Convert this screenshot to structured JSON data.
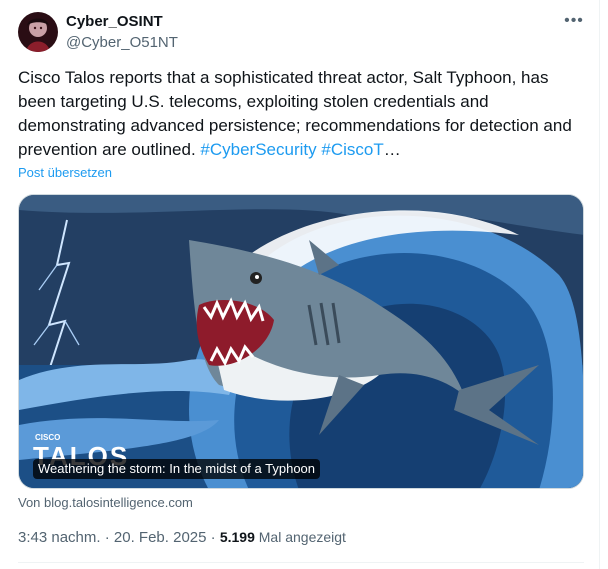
{
  "author": {
    "display_name": "Cyber_OSINT",
    "handle": "@Cyber_O51NT"
  },
  "more_icon": "more-horizontal-icon",
  "tweet": {
    "text": "Cisco Talos reports that a sophisticated threat actor, Salt Typhoon, has been targeting U.S. telecoms, exploiting stolen credentials and demonstrating advanced persistence; recommendations for detection and prevention are outlined. ",
    "hashtag_1": "#CyberSecurity",
    "hashtag_2": "#CiscoT",
    "ellipsis": "…",
    "translate_label": "Post übersetzen"
  },
  "card": {
    "brand_small": "CISCO",
    "brand_large": "TALOS",
    "title": "Weathering the storm: In the midst of a Typhoon",
    "source": "Von blog.talosintelligence.com"
  },
  "meta": {
    "time": "3:43 nachm.",
    "sep1": " · ",
    "date": "20. Feb. 2025",
    "sep2": " · ",
    "views_count": "5.199",
    "views_label": " Mal angezeigt"
  },
  "colors": {
    "accent": "#1d9bf0",
    "secondary_text": "#536471",
    "wave_dark": "#1c4f86",
    "wave_light": "#4a8fd1"
  }
}
